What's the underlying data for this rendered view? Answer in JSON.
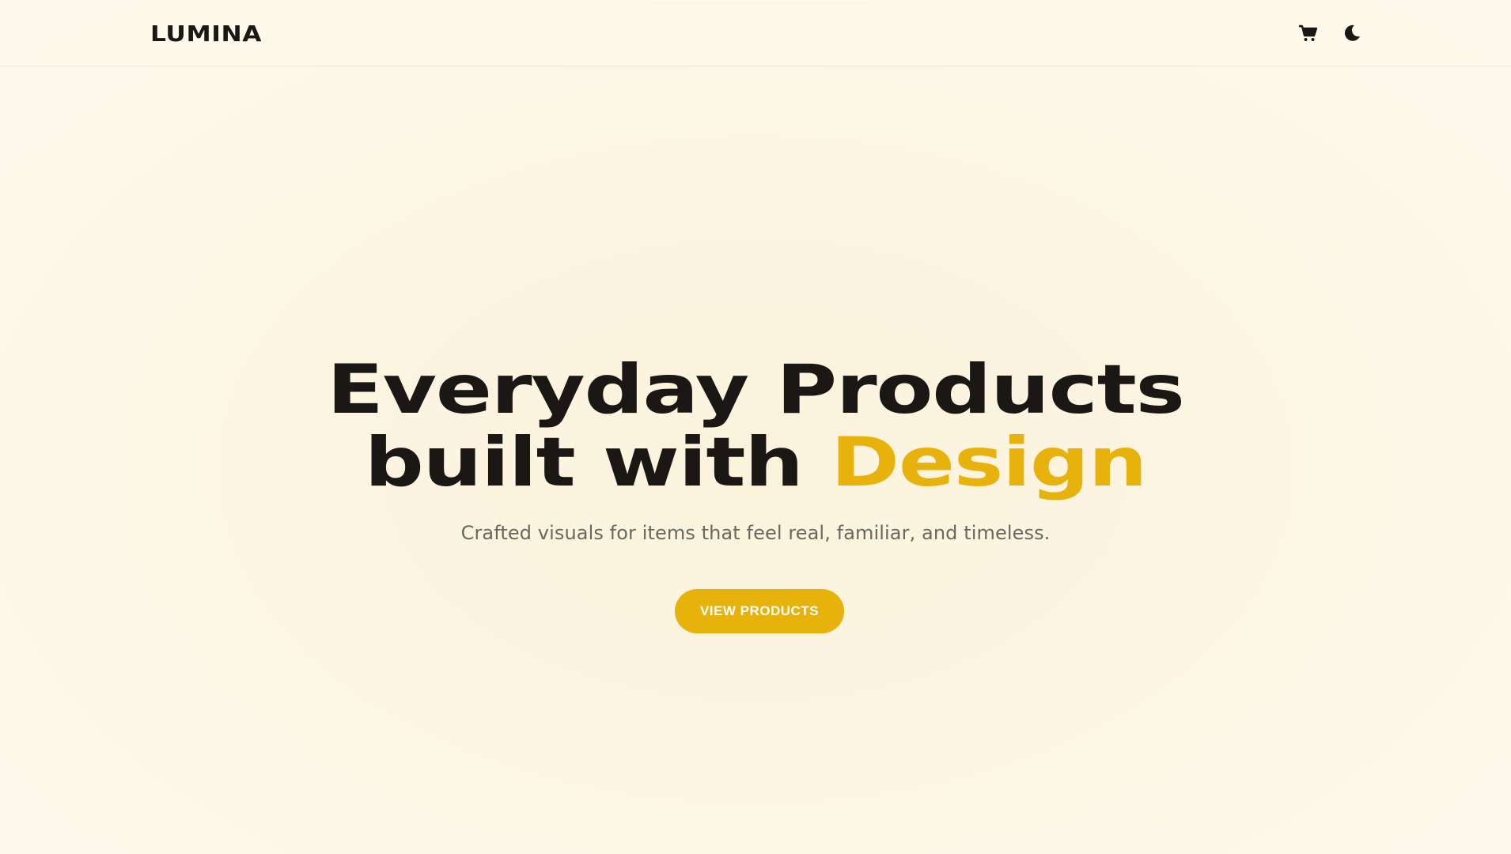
{
  "header": {
    "logo": "LUMINA",
    "icons": [
      "cart-icon",
      "moon-icon"
    ]
  },
  "hero": {
    "title_line1": "Everyday Products",
    "title_line2_prefix": "built with ",
    "title_line2_accent": "Design",
    "subtitle": "Crafted visuals for items that feel real, familiar, and timeless.",
    "cta_label": "VIEW PRODUCTS"
  },
  "colors": {
    "background": "#fdf7e6",
    "text": "#1a1714",
    "accent": "#e8b20c",
    "muted": "#6b6760"
  }
}
